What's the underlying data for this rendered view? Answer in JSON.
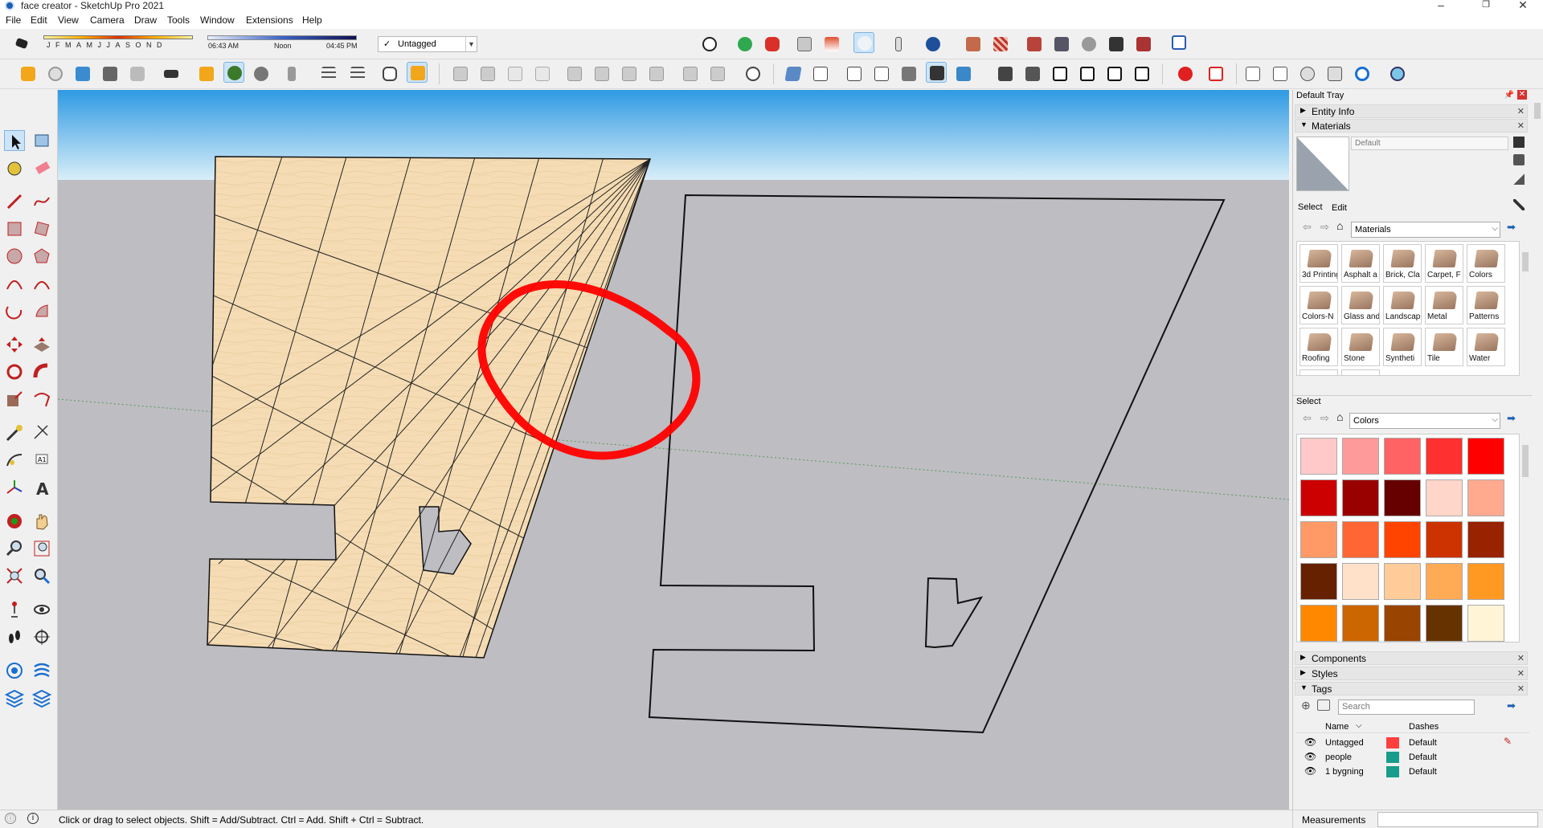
{
  "title": "face creator - SketchUp Pro 2021",
  "menu": [
    "File",
    "Edit",
    "View",
    "Camera",
    "Draw",
    "Tools",
    "Window",
    "Extensions",
    "Help"
  ],
  "shadow": {
    "months": "JFMAMJJASOND",
    "time_start": "06:43 AM",
    "time_mid": "Noon",
    "time_end": "04:45 PM"
  },
  "tag_dropdown": {
    "check": "✓",
    "value": "Untagged"
  },
  "tray": {
    "title": "Default Tray",
    "entity_info": "Entity Info",
    "materials": "Materials",
    "material_name_placeholder": "Default",
    "tab_select": "Select",
    "tab_edit": "Edit",
    "library": "Materials",
    "material_items": [
      "3d Printing",
      "Asphalt a",
      "Brick, Cla",
      "Carpet, F",
      "Colors",
      "Colors-N",
      "Glass and",
      "Landscap",
      "Metal",
      "Patterns",
      "Roofing",
      "Stone",
      "Syntheti",
      "Tile",
      "Water"
    ],
    "select2": "Select",
    "library2": "Colors",
    "swatches": [
      "#ffc9c9",
      "#ff9a9a",
      "#ff6363",
      "#ff3030",
      "#ff0000",
      "#cc0000",
      "#990000",
      "#660000",
      "#ffd6c9",
      "#ffaa8f",
      "#ff9966",
      "#ff6633",
      "#ff4400",
      "#cc3300",
      "#992200",
      "#662200",
      "#ffe0c9",
      "#ffcc99",
      "#ffaa55",
      "#ff9922",
      "#ff8800",
      "#cc6600",
      "#994400",
      "#663300",
      "#fff5d6"
    ],
    "components": "Components",
    "styles": "Styles",
    "tags": "Tags",
    "tags_search_placeholder": "Search",
    "col_name": "Name",
    "col_dashes": "Dashes",
    "tag_rows": [
      {
        "name": "Untagged",
        "color": "#ff3e3e",
        "dash": "Default"
      },
      {
        "name": "people",
        "color": "#1a9c8a",
        "dash": "Default"
      },
      {
        "name": "1 bygning",
        "color": "#1a9c8a",
        "dash": "Default"
      }
    ]
  },
  "status": {
    "message": "Click or drag to select objects. Shift = Add/Subtract. Ctrl = Add. Shift + Ctrl = Subtract.",
    "measurements": "Measurements"
  },
  "colors": {
    "sky_top": "#2f9ae3",
    "sky_bottom": "#d9eef8",
    "ground": "#bdbdc2",
    "face": "#f5dcb4",
    "annotation": "#ff0000"
  }
}
